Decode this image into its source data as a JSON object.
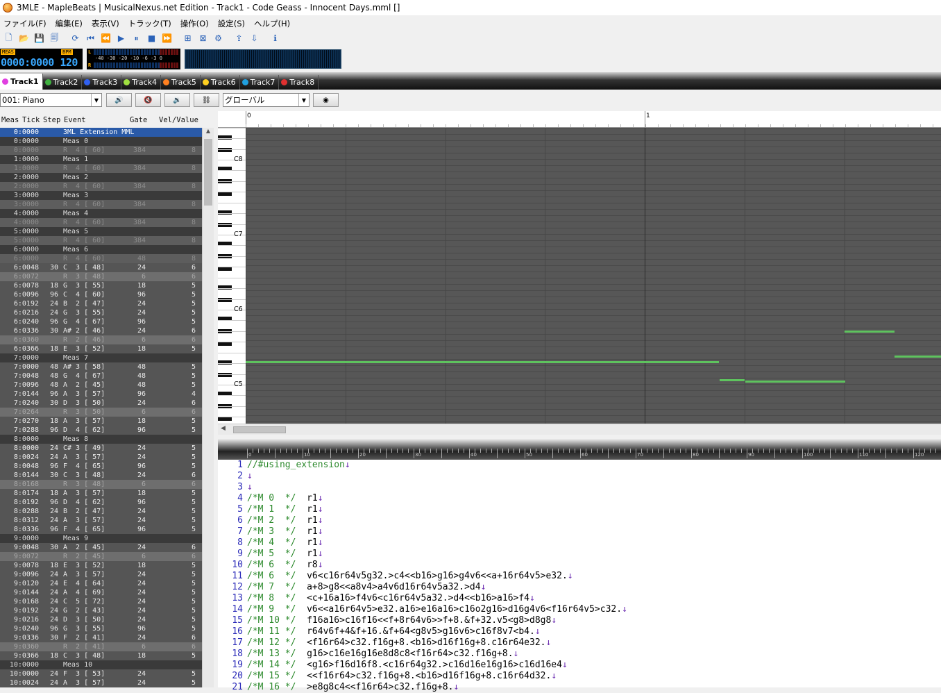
{
  "window": {
    "title": "3MLE - MapleBeats | MusicalNexus.net Edition - Track1 - Code Geass - Innocent Days.mml []"
  },
  "menu": [
    "ファイル(F)",
    "編集(E)",
    "表示(V)",
    "トラック(T)",
    "操作(O)",
    "設定(S)",
    "ヘルプ(H)"
  ],
  "toolbar": {
    "icons": [
      "new-file-icon",
      "open-folder-icon",
      "save-icon",
      "save-all-icon",
      "repeat-icon",
      "skip-start-icon",
      "rewind-icon",
      "play-icon",
      "pause-icon",
      "stop-icon",
      "fast-forward-icon",
      "add-track-icon",
      "delete-track-icon",
      "track-settings-icon",
      "mml-export-icon",
      "mml-import-icon",
      "info-icon"
    ]
  },
  "transport": {
    "meas_label": "MEAS",
    "bpm_label": "BPM",
    "position": "0000:0000",
    "tempo": "120",
    "meter_scale": "-40 -30 -20 -10 -6 -3 0",
    "meter_l": "L",
    "meter_r": "R"
  },
  "tabs": [
    {
      "name": "Track1",
      "color": "#e040e0",
      "active": true
    },
    {
      "name": "Track2",
      "color": "#40b040"
    },
    {
      "name": "Track3",
      "color": "#3060f0"
    },
    {
      "name": "Track4",
      "color": "#a0e040"
    },
    {
      "name": "Track5",
      "color": "#ff8020"
    },
    {
      "name": "Track6",
      "color": "#ffd020"
    },
    {
      "name": "Track7",
      "color": "#20a0e0"
    },
    {
      "name": "Track8",
      "color": "#e03030"
    }
  ],
  "trackbar": {
    "instrument": "001: Piano",
    "scope": "グローバル"
  },
  "event_header": {
    "meas": "Meas",
    "tick": "Tick",
    "step": "Step",
    "event": "Event",
    "gate": "Gate",
    "vel": "Vel/Value"
  },
  "events": [
    {
      "t": "first",
      "pos": "0:0000",
      "ev": "3ML Extension MML"
    },
    {
      "t": "m",
      "pos": "0:0000",
      "ev": "Meas 0"
    },
    {
      "t": "r",
      "pos": "0:0000",
      "ev": "R  4 [ 60]",
      "gate": "384",
      "vel": "8"
    },
    {
      "t": "m",
      "pos": "1:0000",
      "ev": "Meas 1"
    },
    {
      "t": "r",
      "pos": "1:0000",
      "ev": "R  4 [ 60]",
      "gate": "384",
      "vel": "8"
    },
    {
      "t": "m",
      "pos": "2:0000",
      "ev": "Meas 2"
    },
    {
      "t": "r",
      "pos": "2:0000",
      "ev": "R  4 [ 60]",
      "gate": "384",
      "vel": "8"
    },
    {
      "t": "m",
      "pos": "3:0000",
      "ev": "Meas 3"
    },
    {
      "t": "r",
      "pos": "3:0000",
      "ev": "R  4 [ 60]",
      "gate": "384",
      "vel": "8"
    },
    {
      "t": "m",
      "pos": "4:0000",
      "ev": "Meas 4"
    },
    {
      "t": "r",
      "pos": "4:0000",
      "ev": "R  4 [ 60]",
      "gate": "384",
      "vel": "8"
    },
    {
      "t": "m",
      "pos": "5:0000",
      "ev": "Meas 5"
    },
    {
      "t": "r",
      "pos": "5:0000",
      "ev": "R  4 [ 60]",
      "gate": "384",
      "vel": "8"
    },
    {
      "t": "m",
      "pos": "6:0000",
      "ev": "Meas 6"
    },
    {
      "t": "r",
      "pos": "6:0000",
      "ev": "R  4 [ 60]",
      "gate": "48",
      "vel": "8"
    },
    {
      "t": "n",
      "pos": "6:0048",
      "step": "30",
      "ev": "C  3 [ 48]",
      "gate": "24",
      "vel": "6"
    },
    {
      "t": "r2",
      "pos": "6:0072",
      "ev": "R  3 [ 48]",
      "gate": "6",
      "vel": "6"
    },
    {
      "t": "n",
      "pos": "6:0078",
      "step": "18",
      "ev": "G  3 [ 55]",
      "gate": "18",
      "vel": "5"
    },
    {
      "t": "n",
      "pos": "6:0096",
      "step": "96",
      "ev": "C  4 [ 60]",
      "gate": "96",
      "vel": "5"
    },
    {
      "t": "n",
      "pos": "6:0192",
      "step": "24",
      "ev": "B  2 [ 47]",
      "gate": "24",
      "vel": "5"
    },
    {
      "t": "n",
      "pos": "6:0216",
      "step": "24",
      "ev": "G  3 [ 55]",
      "gate": "24",
      "vel": "5"
    },
    {
      "t": "n",
      "pos": "6:0240",
      "step": "96",
      "ev": "G  4 [ 67]",
      "gate": "96",
      "vel": "5"
    },
    {
      "t": "n",
      "pos": "6:0336",
      "step": "30",
      "ev": "A# 2 [ 46]",
      "gate": "24",
      "vel": "6"
    },
    {
      "t": "r2",
      "pos": "6:0360",
      "ev": "R  2 [ 46]",
      "gate": "6",
      "vel": "6"
    },
    {
      "t": "n",
      "pos": "6:0366",
      "step": "18",
      "ev": "E  3 [ 52]",
      "gate": "18",
      "vel": "5"
    },
    {
      "t": "m",
      "pos": "7:0000",
      "ev": "Meas 7"
    },
    {
      "t": "n",
      "pos": "7:0000",
      "step": "48",
      "ev": "A# 3 [ 58]",
      "gate": "48",
      "vel": "5"
    },
    {
      "t": "n",
      "pos": "7:0048",
      "step": "48",
      "ev": "G  4 [ 67]",
      "gate": "48",
      "vel": "5"
    },
    {
      "t": "n",
      "pos": "7:0096",
      "step": "48",
      "ev": "A  2 [ 45]",
      "gate": "48",
      "vel": "5"
    },
    {
      "t": "n",
      "pos": "7:0144",
      "step": "96",
      "ev": "A  3 [ 57]",
      "gate": "96",
      "vel": "4"
    },
    {
      "t": "n",
      "pos": "7:0240",
      "step": "30",
      "ev": "D  3 [ 50]",
      "gate": "24",
      "vel": "6"
    },
    {
      "t": "r2",
      "pos": "7:0264",
      "ev": "R  3 [ 50]",
      "gate": "6",
      "vel": "6"
    },
    {
      "t": "n",
      "pos": "7:0270",
      "step": "18",
      "ev": "A  3 [ 57]",
      "gate": "18",
      "vel": "5"
    },
    {
      "t": "n",
      "pos": "7:0288",
      "step": "96",
      "ev": "D  4 [ 62]",
      "gate": "96",
      "vel": "5"
    },
    {
      "t": "m",
      "pos": "8:0000",
      "ev": "Meas 8"
    },
    {
      "t": "n",
      "pos": "8:0000",
      "step": "24",
      "ev": "C# 3 [ 49]",
      "gate": "24",
      "vel": "5"
    },
    {
      "t": "n",
      "pos": "8:0024",
      "step": "24",
      "ev": "A  3 [ 57]",
      "gate": "24",
      "vel": "5"
    },
    {
      "t": "n",
      "pos": "8:0048",
      "step": "96",
      "ev": "F  4 [ 65]",
      "gate": "96",
      "vel": "5"
    },
    {
      "t": "n",
      "pos": "8:0144",
      "step": "30",
      "ev": "C  3 [ 48]",
      "gate": "24",
      "vel": "6"
    },
    {
      "t": "r2",
      "pos": "8:0168",
      "ev": "R  3 [ 48]",
      "gate": "6",
      "vel": "6"
    },
    {
      "t": "n",
      "pos": "8:0174",
      "step": "18",
      "ev": "A  3 [ 57]",
      "gate": "18",
      "vel": "5"
    },
    {
      "t": "n",
      "pos": "8:0192",
      "step": "96",
      "ev": "D  4 [ 62]",
      "gate": "96",
      "vel": "5"
    },
    {
      "t": "n",
      "pos": "8:0288",
      "step": "24",
      "ev": "B  2 [ 47]",
      "gate": "24",
      "vel": "5"
    },
    {
      "t": "n",
      "pos": "8:0312",
      "step": "24",
      "ev": "A  3 [ 57]",
      "gate": "24",
      "vel": "5"
    },
    {
      "t": "n",
      "pos": "8:0336",
      "step": "96",
      "ev": "F  4 [ 65]",
      "gate": "96",
      "vel": "5"
    },
    {
      "t": "m",
      "pos": "9:0000",
      "ev": "Meas 9"
    },
    {
      "t": "n",
      "pos": "9:0048",
      "step": "30",
      "ev": "A  2 [ 45]",
      "gate": "24",
      "vel": "6"
    },
    {
      "t": "r2",
      "pos": "9:0072",
      "ev": "R  2 [ 45]",
      "gate": "6",
      "vel": "6"
    },
    {
      "t": "n",
      "pos": "9:0078",
      "step": "18",
      "ev": "E  3 [ 52]",
      "gate": "18",
      "vel": "5"
    },
    {
      "t": "n",
      "pos": "9:0096",
      "step": "24",
      "ev": "A  3 [ 57]",
      "gate": "24",
      "vel": "5"
    },
    {
      "t": "n",
      "pos": "9:0120",
      "step": "24",
      "ev": "E  4 [ 64]",
      "gate": "24",
      "vel": "5"
    },
    {
      "t": "n",
      "pos": "9:0144",
      "step": "24",
      "ev": "A  4 [ 69]",
      "gate": "24",
      "vel": "5"
    },
    {
      "t": "n",
      "pos": "9:0168",
      "step": "24",
      "ev": "C  5 [ 72]",
      "gate": "24",
      "vel": "5"
    },
    {
      "t": "n",
      "pos": "9:0192",
      "step": "24",
      "ev": "G  2 [ 43]",
      "gate": "24",
      "vel": "5"
    },
    {
      "t": "n",
      "pos": "9:0216",
      "step": "24",
      "ev": "D  3 [ 50]",
      "gate": "24",
      "vel": "5"
    },
    {
      "t": "n",
      "pos": "9:0240",
      "step": "96",
      "ev": "G  3 [ 55]",
      "gate": "96",
      "vel": "5"
    },
    {
      "t": "n",
      "pos": "9:0336",
      "step": "30",
      "ev": "F  2 [ 41]",
      "gate": "24",
      "vel": "6"
    },
    {
      "t": "r2",
      "pos": "9:0360",
      "ev": "R  2 [ 41]",
      "gate": "6",
      "vel": "6"
    },
    {
      "t": "n",
      "pos": "9:0366",
      "step": "18",
      "ev": "C  3 [ 48]",
      "gate": "18",
      "vel": "5"
    },
    {
      "t": "m",
      "pos": "10:0000",
      "ev": "Meas 10"
    },
    {
      "t": "n",
      "pos": "10:0000",
      "step": "24",
      "ev": "F  3 [ 53]",
      "gate": "24",
      "vel": "5"
    },
    {
      "t": "n",
      "pos": "10:0024",
      "step": "24",
      "ev": "A  3 [ 57]",
      "gate": "24",
      "vel": "5"
    }
  ],
  "pianoroll": {
    "measure_labels": [
      "0",
      "1"
    ],
    "octave_labels": [
      "C8",
      "C7",
      "C6",
      "C5"
    ],
    "note_color": "#5ec35e"
  },
  "editor": {
    "ruler_labels": [
      "0",
      "10",
      "20",
      "30",
      "40",
      "50",
      "60",
      "70",
      "80",
      "90",
      "100",
      "110",
      "120"
    ],
    "lines": [
      {
        "n": "1",
        "html": "<span class='cm'>//#using_extension</span><span class='ret'>↓</span>"
      },
      {
        "n": "2",
        "html": "<span class='ret'>↓</span>"
      },
      {
        "n": "3",
        "html": "<span class='ret'>↓</span>"
      },
      {
        "n": "4",
        "html": "<span class='cm'>/*M 0  */</span>  r1<span class='ret'>↓</span>"
      },
      {
        "n": "5",
        "html": "<span class='cm'>/*M 1  */</span>  r1<span class='ret'>↓</span>"
      },
      {
        "n": "6",
        "html": "<span class='cm'>/*M 2  */</span>  r1<span class='ret'>↓</span>"
      },
      {
        "n": "7",
        "html": "<span class='cm'>/*M 3  */</span>  r1<span class='ret'>↓</span>"
      },
      {
        "n": "8",
        "html": "<span class='cm'>/*M 4  */</span>  r1<span class='ret'>↓</span>"
      },
      {
        "n": "9",
        "html": "<span class='cm'>/*M 5  */</span>  r1<span class='ret'>↓</span>"
      },
      {
        "n": "10",
        "html": "<span class='cm'>/*M 6  */</span>  r8<span class='ret'>↓</span>"
      },
      {
        "n": "11",
        "html": "<span class='cm'>/*M 6  */</span>  v6&lt;c16r64v5g32.&gt;c4&lt;&lt;b16&gt;g16&gt;g4v6&lt;&lt;a+16r64v5&gt;e32.<span class='ret'>↓</span>"
      },
      {
        "n": "12",
        "html": "<span class='cm'>/*M 7  */</span>  a+8&gt;g8&lt;&lt;a8v4&gt;a4v6d16r64v5a32.&gt;d4<span class='ret'>↓</span>"
      },
      {
        "n": "13",
        "html": "<span class='cm'>/*M 8  */</span>  &lt;c+16a16&gt;f4v6&lt;c16r64v5a32.&gt;d4&lt;&lt;b16&gt;a16&gt;f4<span class='ret'>↓</span>"
      },
      {
        "n": "14",
        "html": "<span class='cm'>/*M 9  */</span>  v6&lt;&lt;a16r64v5&gt;e32.a16&gt;e16a16&gt;c16o2g16&gt;d16g4v6&lt;f16r64v5&gt;c32.<span class='ret'>↓</span>"
      },
      {
        "n": "15",
        "html": "<span class='cm'>/*M 10 */</span>  f16a16&gt;c16f16&lt;&lt;f+8r64v6&gt;&gt;f+8.&amp;f+32.v5&lt;g8&gt;d8g8<span class='ret'>↓</span>"
      },
      {
        "n": "16",
        "html": "<span class='cm'>/*M 11 */</span>  r64v6f+4&amp;f+16.&amp;f+64&lt;g8v5&gt;g16v6&gt;c16f8v7&lt;b4.<span class='ret'>↓</span>"
      },
      {
        "n": "17",
        "html": "<span class='cm'>/*M 12 */</span>  &lt;f16r64&gt;c32.f16g+8.&lt;b16&gt;d16f16g+8.c16r64e32.<span class='ret'>↓</span>"
      },
      {
        "n": "18",
        "html": "<span class='cm'>/*M 13 */</span>  g16&gt;c16e16g16e8d8c8&lt;f16r64&gt;c32.f16g+8.<span class='ret'>↓</span>"
      },
      {
        "n": "19",
        "html": "<span class='cm'>/*M 14 */</span>  &lt;g16&gt;f16d16f8.&lt;c16r64g32.&gt;c16d16e16g16&gt;c16d16e4<span class='ret'>↓</span>"
      },
      {
        "n": "20",
        "html": "<span class='cm'>/*M 15 */</span>  &lt;&lt;f16r64&gt;c32.f16g+8.&lt;b16&gt;d16f16g+8.c16r64d32.<span class='ret'>↓</span>"
      },
      {
        "n": "21",
        "html": "<span class='cm'>/*M 16 */</span>  &gt;e8g8c4&lt;&lt;f16r64&gt;c32.f16g+8.<span class='ret'>↓</span>"
      }
    ]
  }
}
